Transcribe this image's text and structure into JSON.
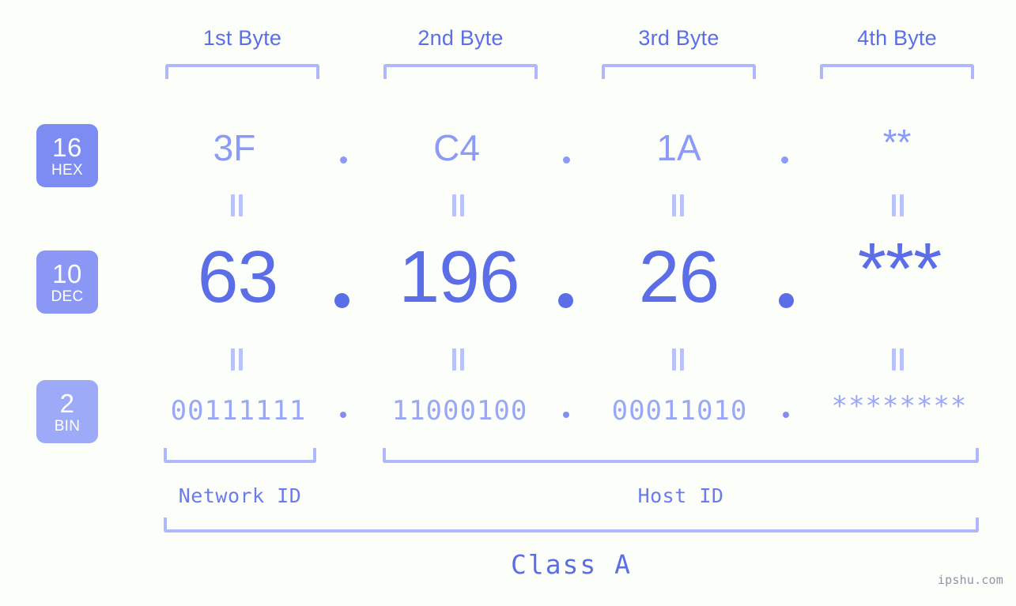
{
  "background_color": "#fcfefa",
  "accent_color": "#5b6ee8",
  "accent_light": "#aeb8fb",
  "header": {
    "bytes": [
      {
        "label": "1st Byte"
      },
      {
        "label": "2nd Byte"
      },
      {
        "label": "3rd Byte"
      },
      {
        "label": "4th Byte"
      }
    ]
  },
  "rows": [
    {
      "badge": {
        "number": "16",
        "name": "HEX",
        "color": "#7d8cf2"
      },
      "values": [
        "3F",
        "C4",
        "1A",
        "**"
      ],
      "separator": "."
    },
    {
      "badge": {
        "number": "10",
        "name": "DEC",
        "color": "#8a97f5"
      },
      "values": [
        "63",
        "196",
        "26",
        "***"
      ],
      "separator": "."
    },
    {
      "badge": {
        "number": "2",
        "name": "BIN",
        "color": "#9daaf8"
      },
      "values": [
        "00111111",
        "11000100",
        "00011010",
        "********"
      ],
      "separator": "."
    }
  ],
  "connector": "||",
  "sections": [
    {
      "label": "Network ID"
    },
    {
      "label": "Host ID"
    }
  ],
  "class": {
    "label": "Class A"
  },
  "watermark": {
    "text": "ipshu.com"
  }
}
